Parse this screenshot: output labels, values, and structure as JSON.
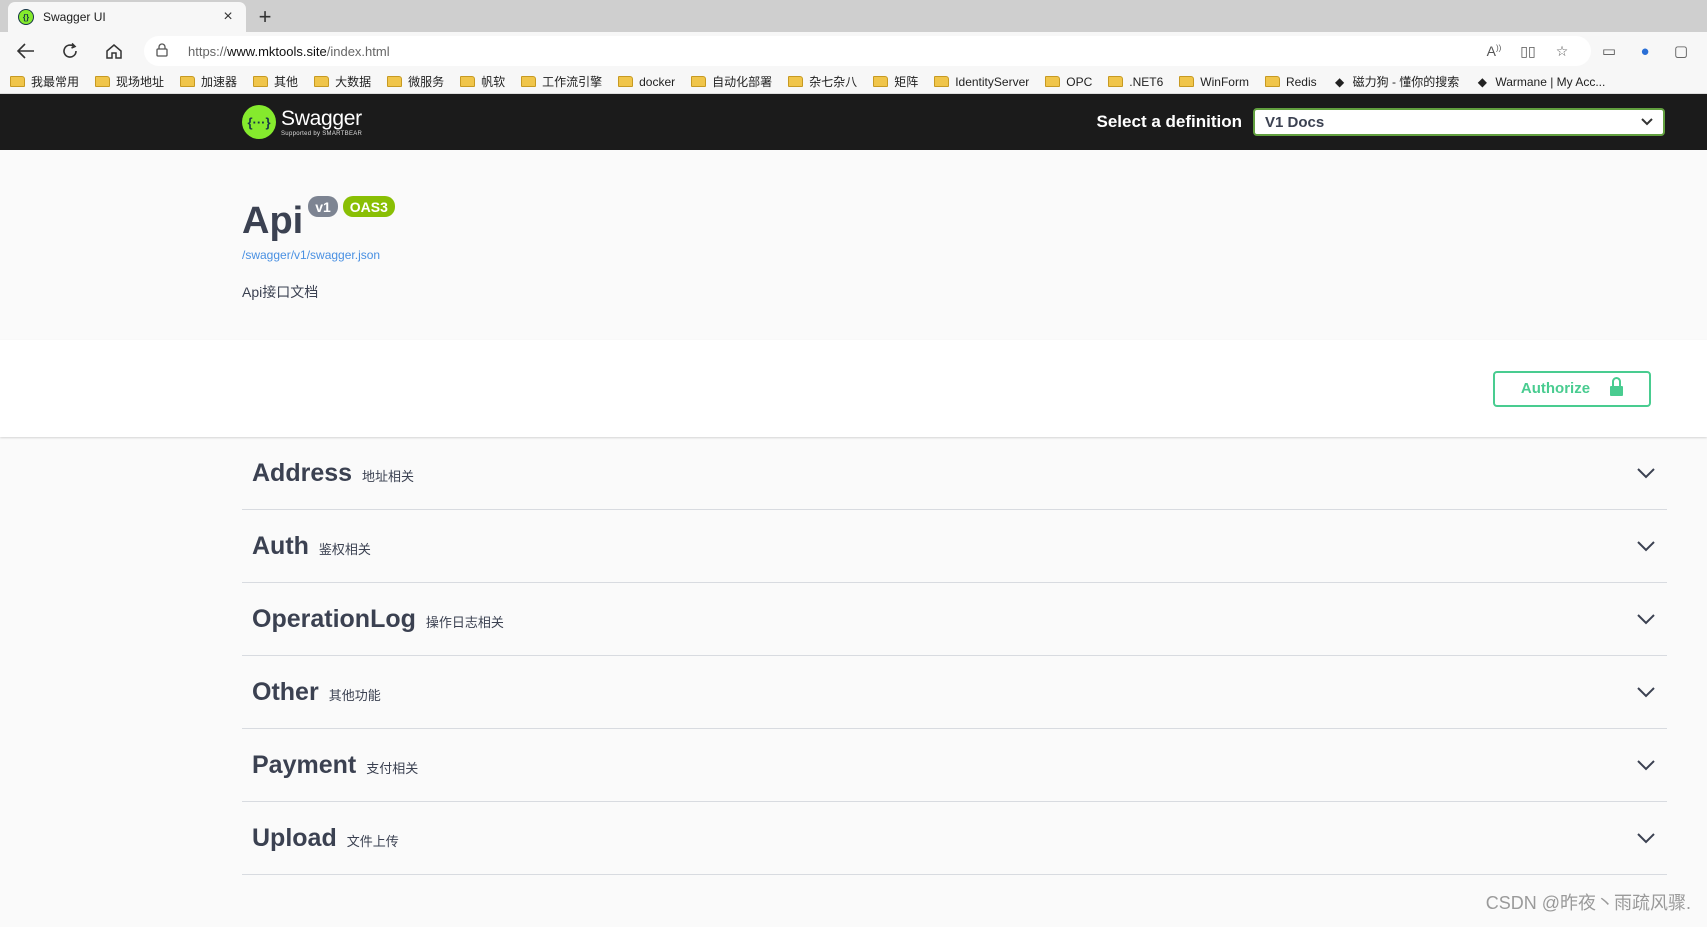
{
  "browser": {
    "tab_title": "Swagger UI",
    "tab_close": "×",
    "new_tab": "+",
    "url_prefix": "https://",
    "url_host": "www.mktools.site",
    "url_path": "/index.html",
    "bookmarks": [
      {
        "label": "我最常用",
        "type": "folder"
      },
      {
        "label": "现场地址",
        "type": "folder"
      },
      {
        "label": "加速器",
        "type": "folder"
      },
      {
        "label": "其他",
        "type": "folder"
      },
      {
        "label": "大数据",
        "type": "folder"
      },
      {
        "label": "微服务",
        "type": "folder"
      },
      {
        "label": "帆软",
        "type": "folder"
      },
      {
        "label": "工作流引擎",
        "type": "folder"
      },
      {
        "label": "docker",
        "type": "folder"
      },
      {
        "label": "自动化部署",
        "type": "folder"
      },
      {
        "label": "杂七杂八",
        "type": "folder"
      },
      {
        "label": "矩阵",
        "type": "folder"
      },
      {
        "label": "IdentityServer",
        "type": "folder"
      },
      {
        "label": "OPC",
        "type": "folder"
      },
      {
        "label": ".NET6",
        "type": "folder"
      },
      {
        "label": "WinForm",
        "type": "folder"
      },
      {
        "label": "Redis",
        "type": "folder"
      },
      {
        "label": "磁力狗 - 懂你的搜索",
        "type": "site"
      },
      {
        "label": "Warmane | My Acc...",
        "type": "site"
      }
    ]
  },
  "swagger": {
    "logo_name": "Swagger",
    "logo_sub": "Supported by SMARTBEAR",
    "definition_label": "Select a definition",
    "definition_value": "V1 Docs",
    "api_title": "Api",
    "version_badge": "v1",
    "oas_badge": "OAS3",
    "spec_link": "/swagger/v1/swagger.json",
    "description": "Api接口文档",
    "authorize_label": "Authorize",
    "tags": [
      {
        "name": "Address",
        "desc": "地址相关"
      },
      {
        "name": "Auth",
        "desc": "鉴权相关"
      },
      {
        "name": "OperationLog",
        "desc": "操作日志相关"
      },
      {
        "name": "Other",
        "desc": "其他功能"
      },
      {
        "name": "Payment",
        "desc": "支付相关"
      },
      {
        "name": "Upload",
        "desc": "文件上传"
      }
    ]
  },
  "watermark": "CSDN @昨夜丶雨疏风骤."
}
